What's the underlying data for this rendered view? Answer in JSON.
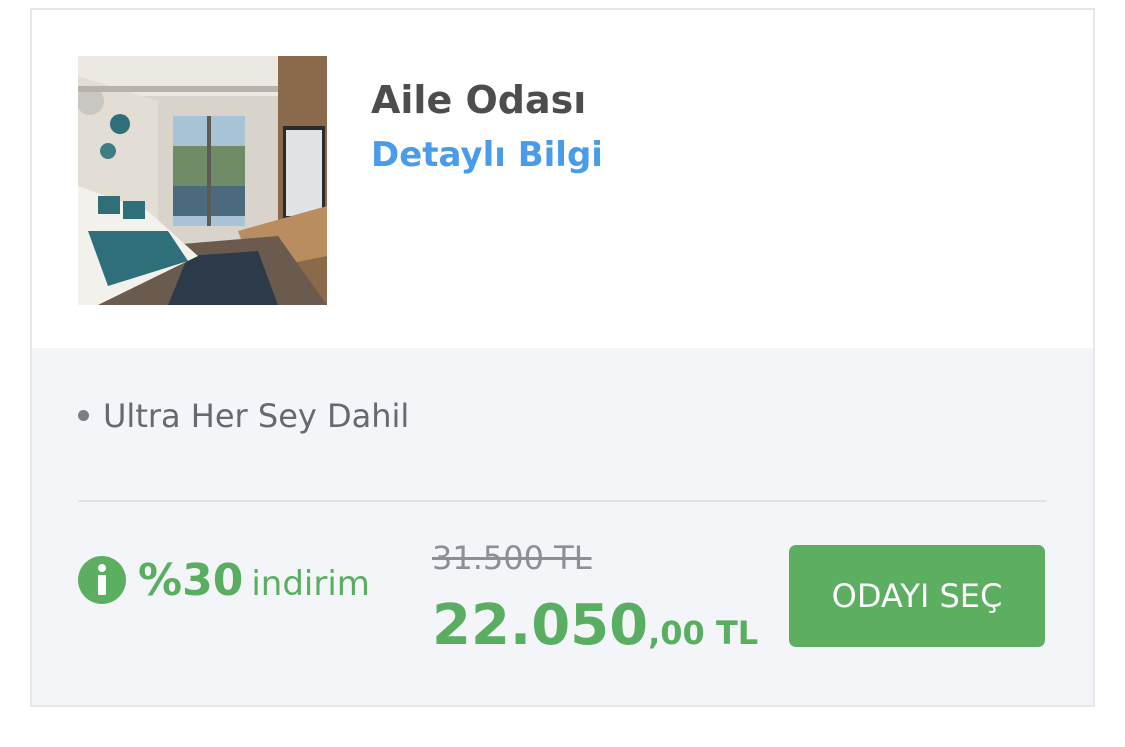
{
  "room": {
    "title": "Aile Odası",
    "detail_link": "Detaylı Bilgi",
    "photo": "hotel-room-photo"
  },
  "features": [
    "Ultra Her Sey Dahil"
  ],
  "pricing": {
    "discount_percent": "%30",
    "discount_word": "indirim",
    "old_price": "31.500 TL",
    "price_main": "22.050",
    "price_cents": ",00 TL"
  },
  "actions": {
    "select_room": "ODAYI SEÇ"
  },
  "icons": {
    "info": "info-icon"
  },
  "colors": {
    "accent_green": "#5cae60",
    "link_blue": "#4a9be9",
    "panel_bg": "#f4f5f9"
  }
}
